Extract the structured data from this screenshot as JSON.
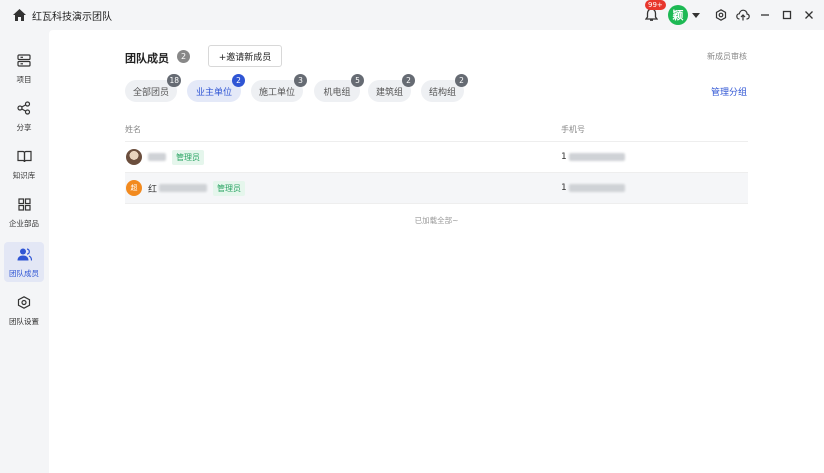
{
  "titlebar": {
    "app_title": "红瓦科技演示团队",
    "home_icon": "home-icon",
    "notification_badge": "99+",
    "user_avatar_text": "颖",
    "icons": [
      "bell-icon",
      "settings-icon",
      "cloud-upload-icon",
      "minimize-icon",
      "maximize-icon",
      "close-icon"
    ]
  },
  "sidebar": {
    "items": [
      {
        "label": "项目",
        "icon": "project-icon"
      },
      {
        "label": "分享",
        "icon": "share-icon"
      },
      {
        "label": "知识库",
        "icon": "book-icon"
      },
      {
        "label": "企业部品",
        "icon": "grid-icon"
      },
      {
        "label": "团队成员",
        "icon": "team-icon",
        "active": true
      },
      {
        "label": "团队设置",
        "icon": "team-settings-icon"
      }
    ]
  },
  "header": {
    "title": "团队成员",
    "count": "2",
    "invite_label": "+邀请新成员",
    "review_label": "新成员审核",
    "manage_groups_label": "管理分组"
  },
  "tabs": [
    {
      "label": "全部团员",
      "badge": "18"
    },
    {
      "label": "业主单位",
      "badge": "2",
      "active": true
    },
    {
      "label": "施工单位",
      "badge": "3"
    },
    {
      "label": "机电组",
      "badge": "5"
    },
    {
      "label": "建筑组",
      "badge": "2"
    },
    {
      "label": "结构组",
      "badge": "2"
    }
  ],
  "table": {
    "headers": {
      "name": "姓名",
      "phone": "手机号"
    },
    "rows": [
      {
        "name_visible": "",
        "name_suffix": "",
        "role": "管理员",
        "phone_prefix": "1"
      },
      {
        "avatar_text": "超",
        "name_visible": "红",
        "name_suffix": "",
        "role": "管理员",
        "phone_prefix": "1"
      }
    ],
    "footer": "已加载全部~"
  },
  "colors": {
    "accent": "#2f55d4",
    "badge_red": "#e8362d",
    "role_green": "#2aa463",
    "user_green": "#1db954"
  }
}
